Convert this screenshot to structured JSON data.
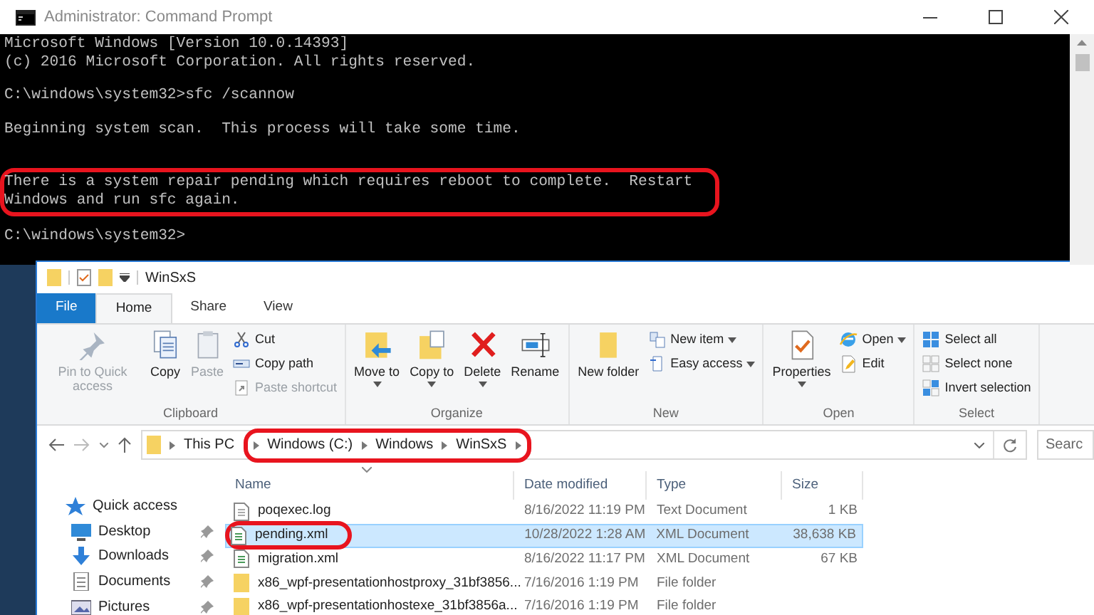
{
  "console_window": {
    "title": "Administrator: Command Prompt",
    "paragraphs": [
      {
        "lines": [
          "Microsoft Windows [Version 10.0.14393]",
          "(c) 2016 Microsoft Corporation. All rights reserved."
        ],
        "highlighted": false
      },
      {
        "lines": [
          "C:\\windows\\system32>sfc /scannow"
        ],
        "highlighted": false
      },
      {
        "lines": [
          "Beginning system scan.  This process will take some time."
        ],
        "highlighted": false
      },
      {
        "lines": [
          "There is a system repair pending which requires reboot to complete.  Restart",
          "Windows and run sfc again."
        ],
        "highlighted": true
      },
      {
        "lines": [
          "C:\\windows\\system32>"
        ],
        "highlighted": false
      }
    ]
  },
  "explorer_window": {
    "title": "WinSxS",
    "tabs": [
      {
        "label": "File",
        "kind": "file",
        "selected": false
      },
      {
        "label": "Home",
        "kind": "tab",
        "selected": true
      },
      {
        "label": "Share",
        "kind": "tab",
        "selected": false
      },
      {
        "label": "View",
        "kind": "tab",
        "selected": false
      }
    ],
    "ribbon_groups": [
      {
        "label": "Clipboard",
        "items": [
          {
            "label": "Pin to Quick access",
            "kind": "large",
            "menu": false,
            "disabled": true
          },
          {
            "label": "Copy",
            "kind": "large",
            "menu": false,
            "disabled": false
          },
          {
            "label": "Paste",
            "kind": "large",
            "menu": false,
            "disabled": true
          },
          {
            "kind": "stack",
            "items": [
              {
                "label": "Cut",
                "menu": false,
                "disabled": false
              },
              {
                "label": "Copy path",
                "menu": false,
                "disabled": false
              },
              {
                "label": "Paste shortcut",
                "menu": false,
                "disabled": true
              }
            ]
          }
        ]
      },
      {
        "label": "Organize",
        "items": [
          {
            "label": "Move to",
            "kind": "large",
            "menu": true,
            "disabled": false
          },
          {
            "label": "Copy to",
            "kind": "large",
            "menu": true,
            "disabled": false
          },
          {
            "label": "Delete",
            "kind": "large",
            "menu": true,
            "disabled": false
          },
          {
            "label": "Rename",
            "kind": "large",
            "menu": false,
            "disabled": false
          }
        ]
      },
      {
        "label": "New",
        "items": [
          {
            "label": "New folder",
            "kind": "large",
            "menu": false,
            "disabled": false
          },
          {
            "kind": "stack",
            "items": [
              {
                "label": "New item",
                "menu": true,
                "disabled": false
              },
              {
                "label": "Easy access",
                "menu": true,
                "disabled": false
              }
            ]
          }
        ]
      },
      {
        "label": "Open",
        "items": [
          {
            "label": "Properties",
            "kind": "large",
            "menu": true,
            "disabled": false
          },
          {
            "kind": "stack",
            "items": [
              {
                "label": "Open",
                "menu": true,
                "disabled": false
              },
              {
                "label": "Edit",
                "menu": false,
                "disabled": false
              }
            ]
          }
        ]
      },
      {
        "label": "Select",
        "items": [
          {
            "kind": "stack",
            "items": [
              {
                "label": "Select all",
                "menu": false,
                "disabled": false
              },
              {
                "label": "Select none",
                "menu": false,
                "disabled": false
              },
              {
                "label": "Invert selection",
                "menu": false,
                "disabled": false
              }
            ]
          }
        ]
      }
    ],
    "breadcrumb": [
      {
        "label": "This PC",
        "highlighted": false
      },
      {
        "label": "Windows (C:)",
        "highlighted": true
      },
      {
        "label": "Windows",
        "highlighted": true
      },
      {
        "label": "WinSxS",
        "highlighted": true
      }
    ],
    "search": {
      "placeholder": "Searc"
    },
    "nav_items": [
      {
        "label": "Quick access",
        "pinned": false
      },
      {
        "label": "Desktop",
        "pinned": true
      },
      {
        "label": "Downloads",
        "pinned": true
      },
      {
        "label": "Documents",
        "pinned": true
      },
      {
        "label": "Pictures",
        "pinned": true
      }
    ],
    "columns": [
      "Name",
      "Date modified",
      "Type",
      "Size"
    ],
    "rows": [
      {
        "kind": "log",
        "name": "poqexec.log",
        "date": "8/16/2022 11:19 PM",
        "type": "Text Document",
        "size": "1 KB",
        "selected": false,
        "highlighted": false
      },
      {
        "kind": "xml",
        "name": "pending.xml",
        "date": "10/28/2022 1:28 AM",
        "type": "XML Document",
        "size": "38,638 KB",
        "selected": true,
        "highlighted": true
      },
      {
        "kind": "xml",
        "name": "migration.xml",
        "date": "8/16/2022 11:17 PM",
        "type": "XML Document",
        "size": "67 KB",
        "selected": false,
        "highlighted": false
      },
      {
        "kind": "folder",
        "name": "x86_wpf-presentationhostproxy_31bf3856...",
        "date": "7/16/2016 1:19 PM",
        "type": "File folder",
        "selected": false,
        "highlighted": false
      },
      {
        "kind": "folder",
        "name": "x86_wpf-presentationhostexe_31bf3856a...",
        "date": "7/16/2016 1:19 PM",
        "type": "File folder",
        "selected": false,
        "highlighted": false
      }
    ]
  }
}
